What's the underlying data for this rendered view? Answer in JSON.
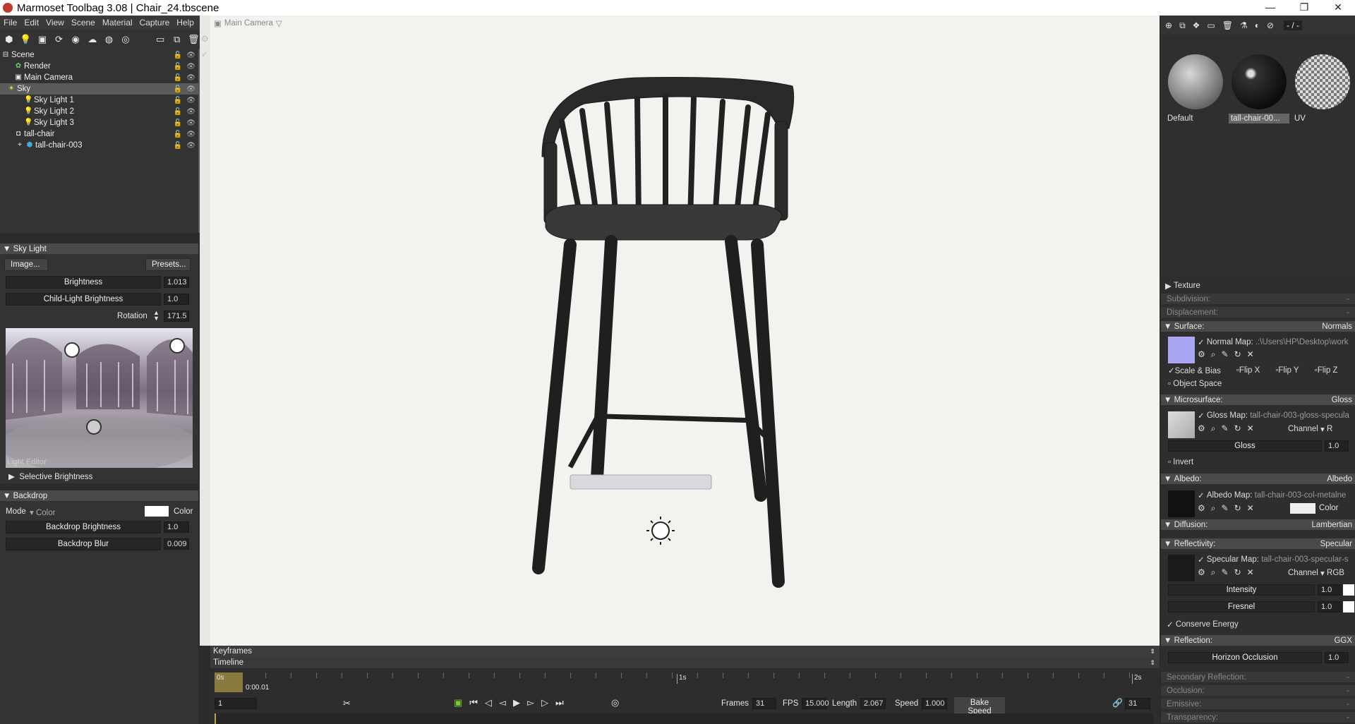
{
  "app": {
    "title": "Marmoset Toolbag 3.08  |  Chair_24.tbscene",
    "min": "—",
    "max": "❐",
    "close": "✕"
  },
  "menu": [
    "File",
    "Edit",
    "View",
    "Scene",
    "Material",
    "Capture",
    "Help"
  ],
  "outliner": {
    "items": [
      {
        "label": "Scene",
        "icon": "scene-icon"
      },
      {
        "label": "Render",
        "icon": "render-icon"
      },
      {
        "label": "Main Camera",
        "icon": "camera-icon"
      },
      {
        "label": "Sky",
        "icon": "sky-icon"
      },
      {
        "label": "Sky Light 1",
        "icon": "light-icon"
      },
      {
        "label": "Sky Light 2",
        "icon": "light-icon"
      },
      {
        "label": "Sky Light 3",
        "icon": "light-icon"
      },
      {
        "label": "tall-chair",
        "icon": "object-icon"
      },
      {
        "label": "tall-chair-003",
        "icon": "mesh-icon"
      }
    ]
  },
  "skylight": {
    "header": "Sky Light",
    "image_btn": "Image...",
    "presets_btn": "Presets...",
    "brightness_label": "Brightness",
    "brightness": "1.013",
    "child_label": "Child-Light Brightness",
    "child": "1.0",
    "rotation_label": "Rotation",
    "rotation": "171.5",
    "editor_label": "Light Editor",
    "selective": "Selective Brightness"
  },
  "backdrop": {
    "header": "Backdrop",
    "mode_label": "Mode",
    "mode_value": "Color",
    "color_label": "Color",
    "brightness_label": "Backdrop Brightness",
    "brightness": "1.0",
    "blur_label": "Backdrop Blur",
    "blur": "0.009"
  },
  "viewport": {
    "camera": "Main Camera"
  },
  "timeline": {
    "keyframes": "Keyframes",
    "timeline": "Timeline",
    "t0": "0s",
    "t1": "1s",
    "t2": "2s",
    "current": "0:00.01",
    "frame": "1",
    "frames_label": "Frames",
    "frames": "31",
    "fps_label": "FPS",
    "fps": "15.000",
    "length_label": "Length",
    "length": "2.067",
    "speed_label": "Speed",
    "speed": "1.000",
    "bake": "Bake Speed",
    "end": "31"
  },
  "materials": {
    "list": [
      {
        "name": "Default"
      },
      {
        "name": "tall-chair-00..."
      },
      {
        "name": "UV"
      }
    ],
    "counter": "- / -"
  },
  "props": {
    "texture": "Texture",
    "subdivision": "Subdivision:",
    "displacement": "Displacement:",
    "surface": "Surface:",
    "surface_val": "Normals",
    "normal_map": "Normal Map:",
    "normal_path": ".:\\Users\\HP\\Desktop\\work",
    "scale_bias": "Scale & Bias",
    "flipx": "Flip X",
    "flipy": "Flip Y",
    "flipz": "Flip Z",
    "object_space": "Object Space",
    "micro": "Microsurface:",
    "micro_val": "Gloss",
    "gloss_map": "Gloss Map:",
    "gloss_path": "tall-chair-003-gloss-specula",
    "channel": "Channel",
    "channel_r": "R",
    "gloss": "Gloss",
    "gloss_val": "1.0",
    "invert": "Invert",
    "albedo": "Albedo:",
    "albedo_val": "Albedo",
    "albedo_map": "Albedo Map:",
    "albedo_path": "tall-chair-003-col-metalne",
    "color": "Color",
    "diffusion": "Diffusion:",
    "diffusion_val": "Lambertian",
    "reflect": "Reflectivity:",
    "reflect_val": "Specular",
    "spec_map": "Specular Map:",
    "spec_path": "tall-chair-003-specular-s",
    "channel_rgb": "RGB",
    "intensity": "Intensity",
    "intensity_val": "1.0",
    "fresnel": "Fresnel",
    "fresnel_val": "1.0",
    "conserve": "Conserve Energy",
    "reflection": "Reflection:",
    "reflection_val": "GGX",
    "horizon": "Horizon Occlusion",
    "horizon_val": "1.0",
    "secondary": "Secondary Reflection:",
    "occlusion": "Occlusion:",
    "emissive": "Emissive:",
    "transparency": "Transparency:",
    "dash": "-"
  }
}
